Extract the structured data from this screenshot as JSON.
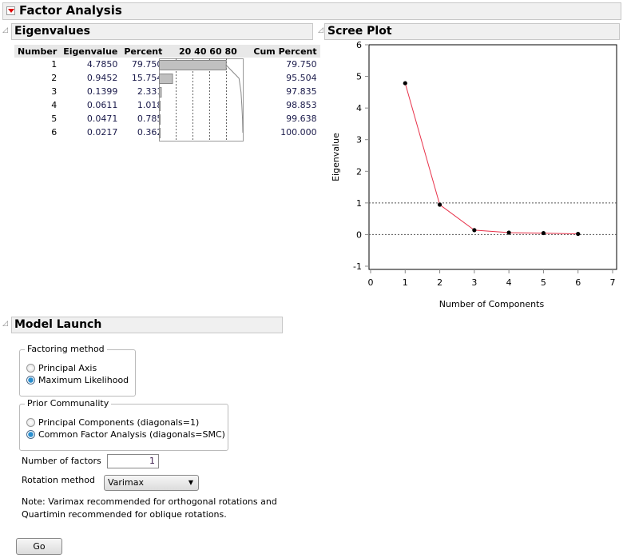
{
  "title": "Factor Analysis",
  "eigen": {
    "title": "Eigenvalues",
    "headers": [
      "Number",
      "Eigenvalue",
      "Percent",
      "20 40 60 80",
      "Cum Percent"
    ],
    "bar_ticks": [
      20,
      40,
      60,
      80
    ],
    "rows": [
      {
        "number": "1",
        "eigenvalue": "4.7850",
        "percent": "79.750",
        "cum": "79.750"
      },
      {
        "number": "2",
        "eigenvalue": "0.9452",
        "percent": "15.754",
        "cum": "95.504"
      },
      {
        "number": "3",
        "eigenvalue": "0.1399",
        "percent": "2.331",
        "cum": "97.835"
      },
      {
        "number": "4",
        "eigenvalue": "0.0611",
        "percent": "1.018",
        "cum": "98.853"
      },
      {
        "number": "5",
        "eigenvalue": "0.0471",
        "percent": "0.785",
        "cum": "99.638"
      },
      {
        "number": "6",
        "eigenvalue": "0.0217",
        "percent": "0.362",
        "cum": "100.000"
      }
    ]
  },
  "scree": {
    "title": "Scree Plot"
  },
  "chart_data": {
    "type": "line",
    "xlabel": "Number of Components",
    "ylabel": "Eigenvalue",
    "x": [
      1,
      2,
      3,
      4,
      5,
      6
    ],
    "y": [
      4.785,
      0.9452,
      0.1399,
      0.0611,
      0.0471,
      0.0217
    ],
    "xlim": [
      0,
      7
    ],
    "ylim": [
      -1,
      6
    ],
    "xticks": [
      0,
      1,
      2,
      3,
      4,
      5,
      6,
      7
    ],
    "yticks": [
      -1,
      0,
      1,
      2,
      3,
      4,
      5,
      6
    ],
    "reference_lines": [
      1,
      0
    ],
    "line_color": "#e8324a",
    "marker_color": "#000000"
  },
  "model": {
    "title": "Model Launch",
    "factoring": {
      "label": "Factoring method",
      "options": [
        "Principal Axis",
        "Maximum Likelihood"
      ],
      "selected": 1
    },
    "prior": {
      "label": "Prior Communality",
      "options": [
        "Principal Components (diagonals=1)",
        "Common Factor Analysis (diagonals=SMC)"
      ],
      "selected": 1
    },
    "num_factors_label": "Number of factors",
    "num_factors": "1",
    "rotation_label": "Rotation method",
    "rotation": "Varimax",
    "note1": "Note: Varimax recommended for orthogonal rotations and",
    "note2": "Quartimin recommended for oblique rotations.",
    "go": "Go"
  }
}
